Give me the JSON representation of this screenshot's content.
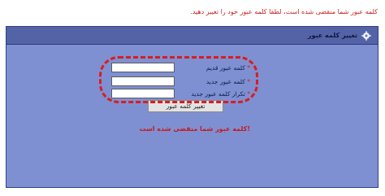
{
  "notice": {
    "text": "کلمه عبور شما منقضی شده است، لطفا کلمه عبور خود را تغییر دهید."
  },
  "panel": {
    "title": "تغییر کلمه عبور",
    "icon": "gear-icon"
  },
  "form": {
    "fields": [
      {
        "label": "کلمه عبور قدیم",
        "value": ""
      },
      {
        "label": "کلمه عبور جدید",
        "value": ""
      },
      {
        "label": "تکرار کلمه عبور جدید",
        "value": ""
      }
    ],
    "required_mark": "*",
    "submit_label": "تغییر کلمه عبور",
    "error": "!کلمه عبور شما منقضی شده است"
  },
  "colors": {
    "panel_background": "#7f90d2",
    "header_background": "#5463a6",
    "alert_red": "#cc1f1f",
    "highlight_annotation": "#d81e1e"
  }
}
